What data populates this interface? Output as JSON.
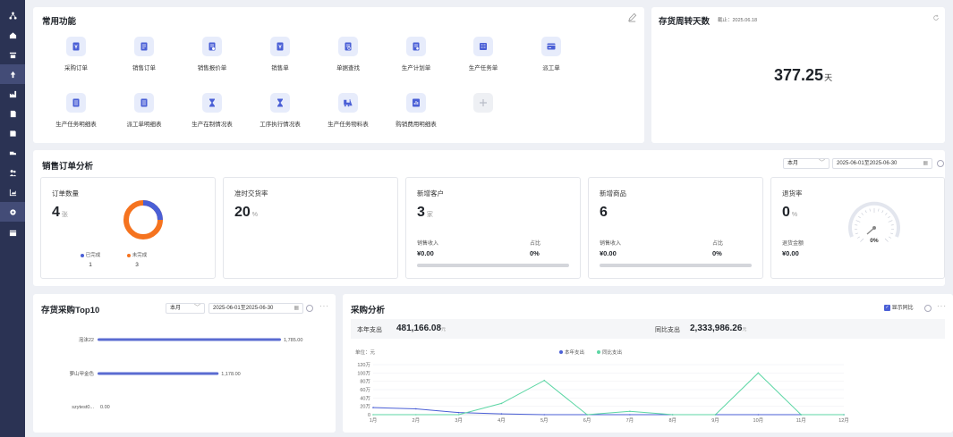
{
  "sidebar": {
    "items": [
      {
        "icon": "network-icon",
        "active": false
      },
      {
        "icon": "home-icon",
        "active": false
      },
      {
        "icon": "tools-icon",
        "active": false
      },
      {
        "icon": "recycle-icon",
        "active": true
      },
      {
        "icon": "factory-icon",
        "active": false
      },
      {
        "icon": "document-icon",
        "active": false
      },
      {
        "icon": "save-icon",
        "active": false
      },
      {
        "icon": "truck-icon",
        "active": false
      },
      {
        "icon": "people-icon",
        "active": false
      },
      {
        "icon": "chart-icon",
        "active": false
      },
      {
        "icon": "settings-icon",
        "active": true
      },
      {
        "icon": "calendar-icon",
        "active": false
      }
    ]
  },
  "common": {
    "title": "常用功能",
    "items": [
      {
        "label": "采购订单",
        "icon": "yen-doc-icon"
      },
      {
        "label": "销售订单",
        "icon": "order-doc-icon"
      },
      {
        "label": "销售报价单",
        "icon": "quote-doc-icon"
      },
      {
        "label": "销售单",
        "icon": "yen-doc-icon"
      },
      {
        "label": "单据查找",
        "icon": "search-doc-icon"
      },
      {
        "label": "生产计划单",
        "icon": "plan-doc-icon"
      },
      {
        "label": "生产任务单",
        "icon": "task-doc-icon"
      },
      {
        "label": "派工单",
        "icon": "card-icon"
      },
      {
        "label": "生产任务明细表",
        "icon": "list-doc-icon"
      },
      {
        "label": "派工单明细表",
        "icon": "list-doc-icon"
      },
      {
        "label": "生产在制情况表",
        "icon": "hourglass-icon"
      },
      {
        "label": "工序执行情况表",
        "icon": "hourglass-icon"
      },
      {
        "label": "生产任务物料表",
        "icon": "forklift-icon"
      },
      {
        "label": "购销费用明细表",
        "icon": "bar-doc-icon"
      }
    ]
  },
  "turnover": {
    "title": "存货周转天数",
    "date": "截止：2025.06.18",
    "value": "377.25",
    "unit": "天"
  },
  "sales": {
    "title": "销售订单分析",
    "period": "本月",
    "range": "2025-06-01至2025-06-30",
    "order_count": {
      "title": "订单数量",
      "value": "4",
      "unit": "张",
      "legend": [
        {
          "label": "已完成",
          "count": "1",
          "color": "#4a5fd6"
        },
        {
          "label": "未完成",
          "count": "3",
          "color": "#f5731f"
        }
      ],
      "fraction_done": 0.25
    },
    "on_time": {
      "title": "准时交货率",
      "value": "20",
      "unit": "%"
    },
    "new_customers": {
      "title": "新增客户",
      "value": "3",
      "unit": "家",
      "revenue_label": "销售收入",
      "revenue": "¥0.00",
      "share_label": "占比",
      "share": "0%"
    },
    "new_products": {
      "title": "新增商品",
      "value": "6",
      "revenue_label": "销售收入",
      "revenue": "¥0.00",
      "share_label": "占比",
      "share": "0%"
    },
    "return_rate": {
      "title": "退货率",
      "value": "0",
      "unit": "%",
      "amount_label": "退货金额",
      "amount": "¥0.00",
      "gauge": "0%"
    }
  },
  "top10": {
    "title": "存货采购Top10",
    "period": "本月",
    "range": "2025-06-01至2025-06-30"
  },
  "purchase": {
    "title": "采购分析",
    "show_yoy": "显示同比",
    "year_label": "本年支出",
    "year_value": "481,166.08",
    "yoy_label": "同比支出",
    "yoy_value": "2,333,986.26",
    "currency": "元",
    "unit_label": "单位：元"
  },
  "colors": {
    "sidebar": "#2b3354",
    "accent": "#4a5fd6",
    "orange": "#f5731f",
    "green": "#5cd6a4"
  },
  "chart_data": [
    {
      "type": "bar",
      "orientation": "horizontal",
      "categories": [
        "泡沫22",
        "萝山甲金色",
        "szytest0..."
      ],
      "values": [
        1785.0,
        1178.0,
        0.0
      ],
      "data_labels": [
        "1,785.00",
        "1,178.00",
        "0.00"
      ],
      "xlim": [
        0,
        1785
      ]
    },
    {
      "type": "line",
      "categories": [
        "1月",
        "2月",
        "3月",
        "4月",
        "5月",
        "6月",
        "7月",
        "8月",
        "9月",
        "10月",
        "11月",
        "12月"
      ],
      "series": [
        {
          "name": "本年支出",
          "values": [
            17,
            14,
            5,
            2,
            0,
            0,
            0,
            0,
            0,
            0,
            0,
            0
          ],
          "color": "#4a5fd6"
        },
        {
          "name": "同比支出",
          "values": [
            0,
            0,
            0,
            27,
            82,
            0,
            8,
            0,
            0,
            100,
            0,
            0
          ],
          "color": "#5cd6a4"
        }
      ],
      "yticks": [
        "120万",
        "100万",
        "80万",
        "60万",
        "40万",
        "20万",
        "0"
      ],
      "ylim": [
        0,
        120
      ],
      "ylabel": "单位：元"
    }
  ]
}
